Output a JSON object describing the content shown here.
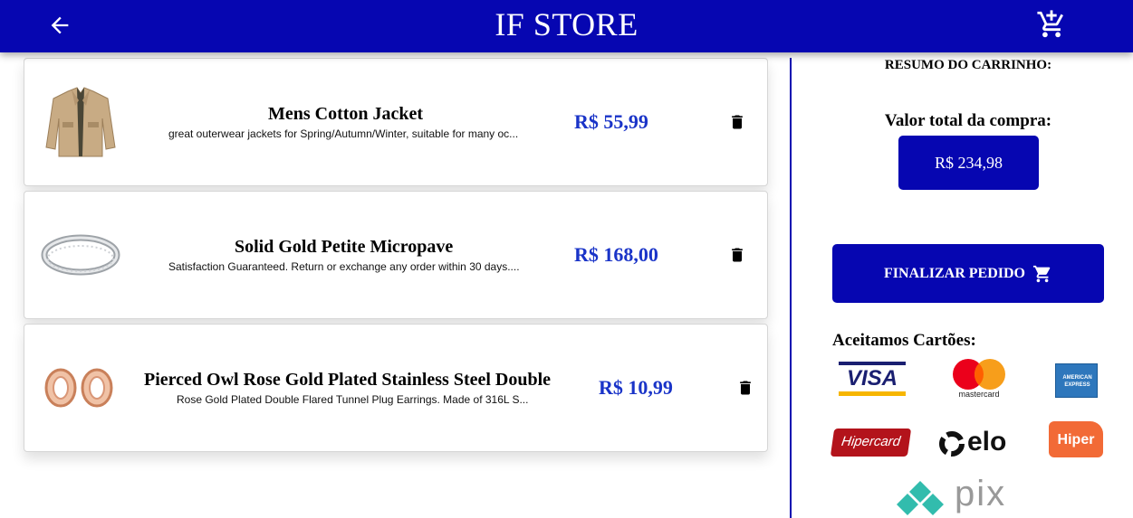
{
  "header": {
    "title": "IF STORE",
    "back_icon": "arrow-left-icon",
    "cart_icon": "cart-plus-icon",
    "color": "#0606b1"
  },
  "cart": {
    "items": [
      {
        "name": "Mens Cotton Jacket",
        "description": "great outerwear jackets for Spring/Autumn/Winter, suitable for many oc...",
        "price": "R$ 55,99",
        "image_icon": "jacket-image"
      },
      {
        "name": "Solid Gold Petite Micropave",
        "description": "Satisfaction Guaranteed. Return or exchange any order within 30 days....",
        "price": "R$ 168,00",
        "image_icon": "ring-image"
      },
      {
        "name": "Pierced Owl Rose Gold Plated Stainless Steel Double",
        "description": "Rose Gold Plated Double Flared Tunnel Plug Earrings. Made of 316L S...",
        "price": "R$ 10,99",
        "image_icon": "earrings-image"
      }
    ],
    "delete_icon": "trash-icon",
    "price_color": "#1a34c8"
  },
  "summary": {
    "title": "RESUMO DO CARRINHO:",
    "total_label": "Valor total da compra:",
    "total_value": "R$ 234,98",
    "checkout_label": "FINALIZAR PEDIDO",
    "checkout_icon": "cart-icon",
    "cards_title": "Aceitamos Cartões:",
    "payment_logos": {
      "visa": "VISA",
      "mastercard": "mastercard",
      "amex_line1": "AMERICAN",
      "amex_line2": "EXPRESS",
      "hipercard": "Hipercard",
      "elo": "elo",
      "hiper": "Hiper",
      "pix": "pix"
    }
  }
}
